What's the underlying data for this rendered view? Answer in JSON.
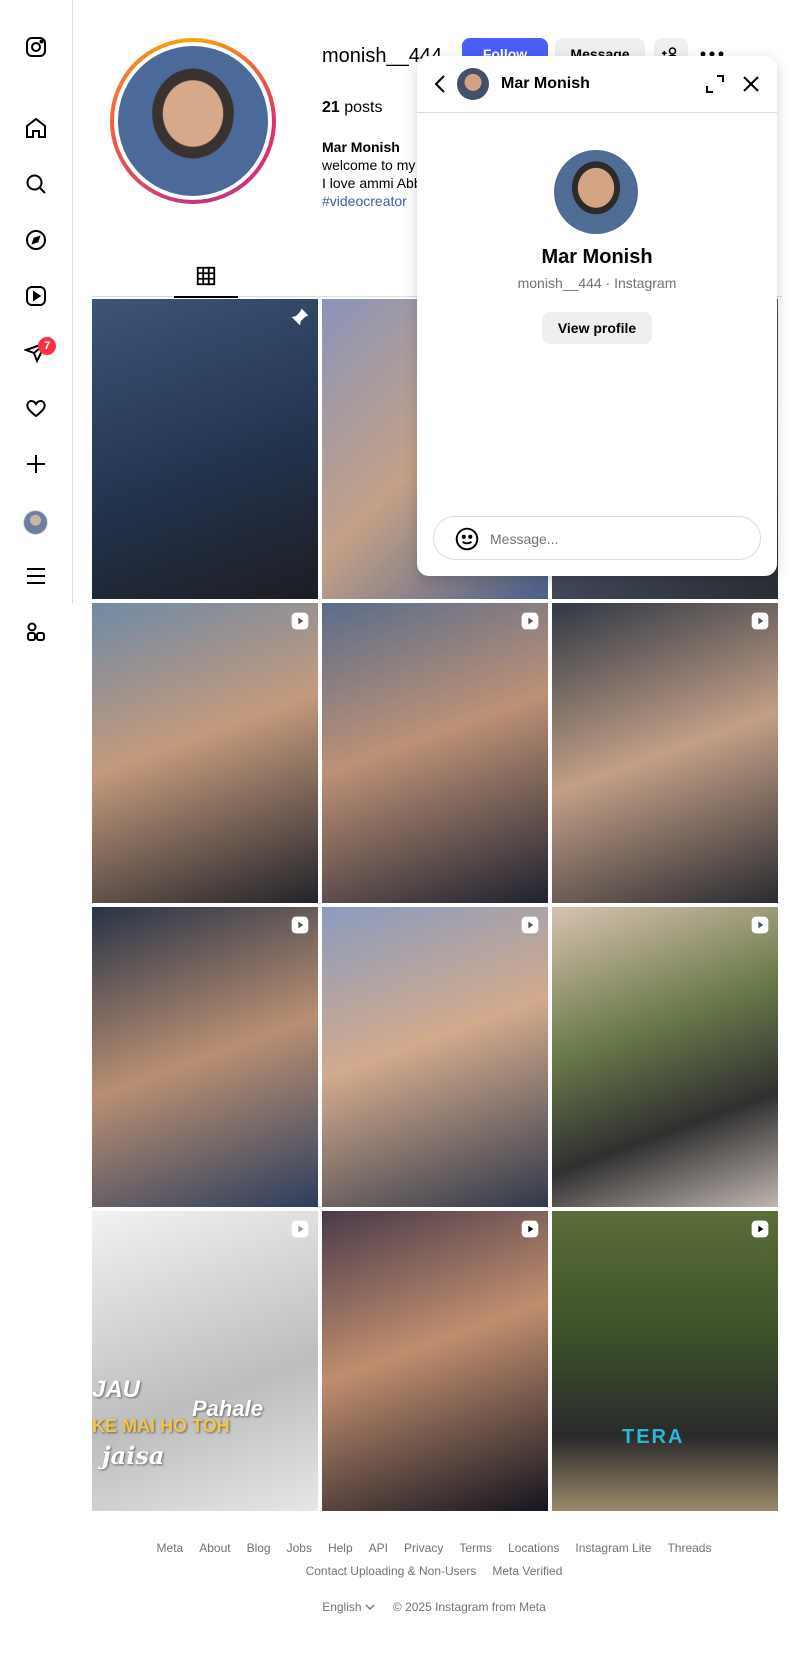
{
  "nav": {
    "items": [
      {
        "name": "instagram-logo-icon"
      },
      {
        "name": "home-icon"
      },
      {
        "name": "search-icon"
      },
      {
        "name": "explore-icon"
      },
      {
        "name": "reels-icon"
      },
      {
        "name": "messages-icon"
      },
      {
        "name": "notifications-icon"
      },
      {
        "name": "create-icon"
      },
      {
        "name": "profile-icon"
      },
      {
        "name": "more-menu-icon"
      },
      {
        "name": "threads-apps-icon"
      }
    ],
    "messages_badge": "7"
  },
  "profile": {
    "username": "monish__444",
    "follow_label": "Follow",
    "message_label": "Message",
    "add_user_label": "+",
    "posts_count": "21",
    "posts_label": "posts",
    "bio_name": "Mar Monish",
    "bio_lines": [
      "welcome to my",
      "I love ammi Abb"
    ],
    "bio_tag": "#videocreator"
  },
  "tiles": [
    {
      "icon": "pin-icon",
      "text": []
    },
    {
      "icon": "",
      "text": []
    },
    {
      "icon": "",
      "text": []
    },
    {
      "icon": "reel-icon",
      "text": []
    },
    {
      "icon": "reel-icon",
      "text": []
    },
    {
      "icon": "reel-icon",
      "text": []
    },
    {
      "icon": "reel-icon",
      "text": []
    },
    {
      "icon": "reel-icon",
      "text": []
    },
    {
      "icon": "reel-icon",
      "text": []
    },
    {
      "icon": "reel-icon",
      "text": [
        "JAU",
        "Pahale",
        "KE MAI HO TOH",
        "jaisa"
      ]
    },
    {
      "icon": "reel-icon",
      "text": []
    },
    {
      "icon": "reel-icon",
      "text": [
        "TERA"
      ]
    }
  ],
  "chat": {
    "header_name": "Mar Monish",
    "full_name": "Mar Monish",
    "subtitle": "monish__444 · Instagram",
    "view_profile_label": "View profile",
    "input_placeholder": "Message..."
  },
  "footer": {
    "links_row1": [
      "Meta",
      "About",
      "Blog",
      "Jobs",
      "Help",
      "API",
      "Privacy",
      "Terms",
      "Locations",
      "Instagram Lite",
      "Threads"
    ],
    "links_row2": [
      "Contact Uploading & Non-Users",
      "Meta Verified"
    ],
    "language": "English",
    "copyright": "© 2025 Instagram from Meta"
  },
  "colors": {
    "accent": "#4a5df9",
    "badge": "#ff3040",
    "hashtag": "#3e5aa8"
  }
}
